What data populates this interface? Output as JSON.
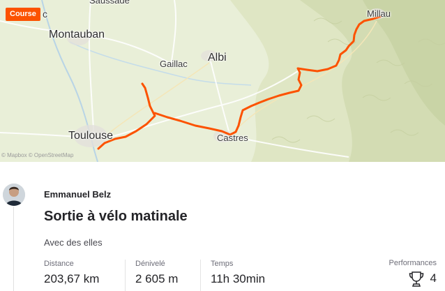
{
  "map": {
    "badge": "Course",
    "attribution": "© Mapbox © OpenStreetMap",
    "route_color": "#fc5200",
    "places": {
      "saussade": "Saussade",
      "caussade_fragment": "c",
      "montauban": "Montauban",
      "gaillac": "Gaillac",
      "albi": "Albi",
      "toulouse": "Toulouse",
      "castres": "Castres",
      "millau": "Millau"
    }
  },
  "activity": {
    "athlete": "Emmanuel Belz",
    "title": "Sortie à vélo matinale",
    "description": "Avec des elles",
    "avatar_icon": "user-avatar"
  },
  "stats": [
    {
      "label": "Distance",
      "value": "203,67 km"
    },
    {
      "label": "Dénivelé",
      "value": "2 605 m"
    },
    {
      "label": "Temps",
      "value": "11h 30min"
    }
  ],
  "performances": {
    "label": "Performances",
    "count": "4",
    "icon": "trophy-icon"
  }
}
